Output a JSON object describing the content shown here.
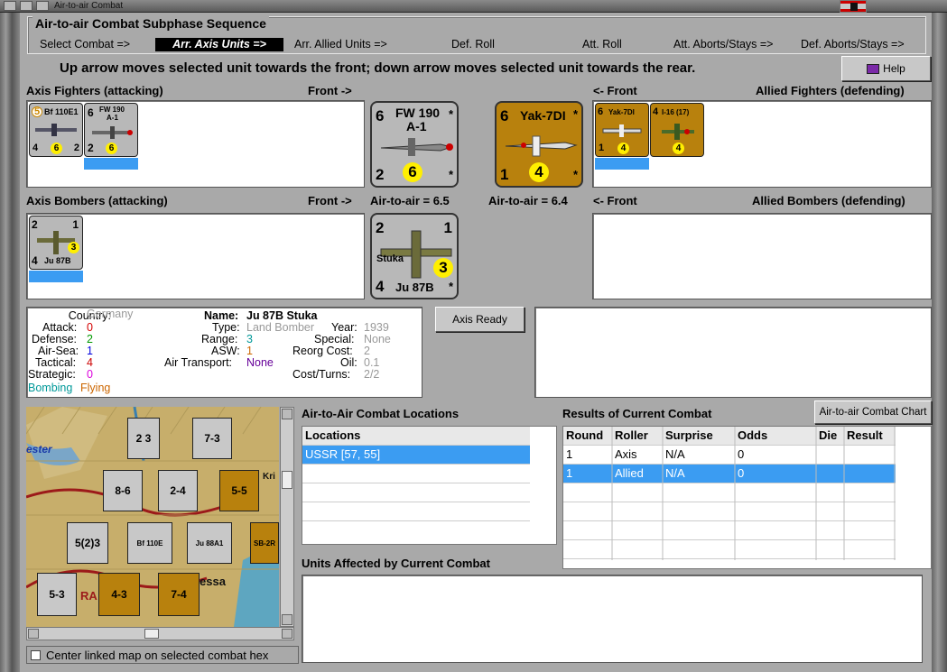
{
  "window": {
    "title": "Air-to-air Combat"
  },
  "sequence": {
    "title": "Air-to-air Combat Subphase Sequence",
    "steps": [
      "Select Combat =>",
      "Arr. Axis Units =>",
      "Arr. Allied Units =>",
      "Def. Roll",
      "Att. Roll",
      "Att. Aborts/Stays =>",
      "Def. Aborts/Stays =>"
    ],
    "active_index": 1
  },
  "instruction": "Up arrow moves selected unit towards the front; down arrow moves selected unit towards the rear.",
  "help_label": "Help",
  "axis_fighters": {
    "label": "Axis Fighters (attacking)",
    "front": "Front ->",
    "units": [
      {
        "name": "Bf 110E1",
        "top_left": "5",
        "bottom_left": "4",
        "bottom_right": "2",
        "circle": "6"
      },
      {
        "name": "FW 190",
        "sub": "A-1",
        "top_left": "6",
        "bottom_left": "2",
        "circle": "6",
        "selected": true
      }
    ]
  },
  "allied_fighters": {
    "label": "Allied Fighters (defending)",
    "front": "<- Front",
    "units": [
      {
        "name": "Yak-7DI",
        "top_left": "6",
        "bottom_left": "1",
        "circle": "4",
        "selected": true
      },
      {
        "name": "I-16 (17)",
        "top_left": "4",
        "circle": "4"
      }
    ]
  },
  "axis_bombers": {
    "label": "Axis Bombers (attacking)",
    "front": "Front ->",
    "units": [
      {
        "name": "Ju 87B",
        "top_left": "2",
        "top_right": "1",
        "bottom_left": "4",
        "circle": "3",
        "selected": true
      }
    ]
  },
  "allied_bombers": {
    "label": "Allied Bombers (defending)",
    "front": "<- Front"
  },
  "big_axis_fighter": {
    "name": "FW 190",
    "sub": "A-1",
    "top_left": "6",
    "bottom_left": "2",
    "circle": "6",
    "star": "*"
  },
  "big_allied_fighter": {
    "name": "Yak-7DI",
    "top_left": "6",
    "bottom_left": "1",
    "circle": "4",
    "star": "*"
  },
  "big_axis_bomber": {
    "top_left": "2",
    "top_right": "1",
    "name": "Stuka",
    "bottom_left": "4",
    "bottom_name": "Ju 87B",
    "circle": "3",
    "star": "*"
  },
  "axis_a2a": "Air-to-air = 6.5",
  "allied_a2a": "Air-to-air = 6.4",
  "unit_info": {
    "country_k": "Country:",
    "country_v": "Germany",
    "attack_k": "Attack:",
    "attack_v": "0",
    "defense_k": "Defense:",
    "defense_v": "2",
    "airsea_k": "Air-Sea:",
    "airsea_v": "1",
    "tactical_k": "Tactical:",
    "tactical_v": "4",
    "strategic_k": "Strategic:",
    "strategic_v": "0",
    "bombing": "Bombing",
    "flying": "Flying",
    "name_k": "Name:",
    "name_v": "Ju 87B Stuka",
    "type_k": "Type:",
    "type_v": "Land Bomber",
    "year_k": "Year:",
    "year_v": "1939",
    "range_k": "Range:",
    "range_v": "3",
    "special_k": "Special:",
    "special_v": "None",
    "asw_k": "ASW:",
    "asw_v": "1",
    "reorg_k": "Reorg Cost:",
    "reorg_v": "2",
    "airtrans_k": "Air Transport:",
    "airtrans_v": "None",
    "oil_k": "Oil:",
    "oil_v": "0.1",
    "cost_k": "Cost/Turns:",
    "cost_v": "2/2"
  },
  "axis_ready_label": "Axis Ready",
  "locations": {
    "title": "Air-to-Air Combat Locations",
    "header": "Locations",
    "rows": [
      "USSR [57, 55]"
    ]
  },
  "results": {
    "title": "Results of Current Combat",
    "chart_button": "Air-to-air Combat Chart",
    "headers": [
      "Round",
      "Roller",
      "Surprise",
      "Odds",
      "Die",
      "Result"
    ],
    "rows": [
      [
        "1",
        "Axis",
        "N/A",
        "0",
        "",
        ""
      ],
      [
        "1",
        "Allied",
        "N/A",
        "0",
        "",
        ""
      ]
    ]
  },
  "affected": {
    "title": "Units Affected by Current Combat"
  },
  "map": {
    "label_city1": "ester",
    "label_city2": "essa",
    "label_ra": "RA",
    "label_kri": "Kri",
    "counters": [
      {
        "id": "c1",
        "t": "xx",
        "v": "2 3"
      },
      {
        "id": "c2",
        "t": "xxx",
        "v": "7-3"
      },
      {
        "id": "c3",
        "t": "",
        "v": "8-6"
      },
      {
        "id": "c4",
        "t": "xx",
        "v": "2-4"
      },
      {
        "id": "c5",
        "t": "xxxx",
        "v": "5-5"
      },
      {
        "id": "c6",
        "t": "xxxxx",
        "v": "5(2)3"
      },
      {
        "id": "c7",
        "t": "",
        "v": "Bf 110E"
      },
      {
        "id": "c8",
        "t": "",
        "v": "Ju 88A1"
      },
      {
        "id": "c9",
        "t": "",
        "v": "SB-2R"
      },
      {
        "id": "c10",
        "t": "",
        "v": "5-3"
      },
      {
        "id": "c11",
        "t": "xxxx",
        "v": "4-3"
      },
      {
        "id": "c12",
        "t": "xxxx",
        "v": "7-4"
      }
    ]
  },
  "center_linked": "Center linked map on selected combat hex"
}
